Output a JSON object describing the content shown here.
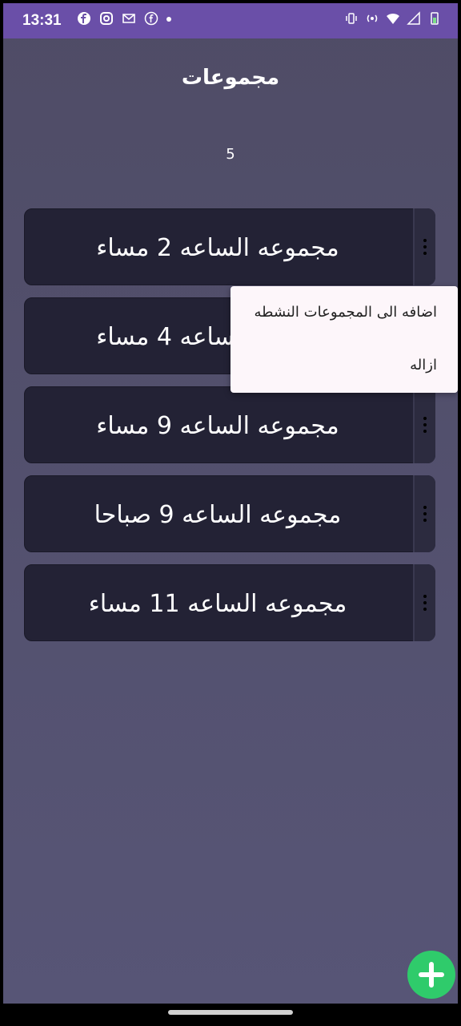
{
  "status_bar": {
    "time": "13:31",
    "left_icons": [
      "facebook-icon",
      "instagram-icon",
      "gmail-icon",
      "facebook-icon"
    ],
    "right_icons": [
      "vibrate-icon",
      "hotspot-icon",
      "wifi-icon",
      "signal-icon",
      "battery-icon"
    ]
  },
  "header": {
    "title": "مجموعات",
    "count": "5"
  },
  "groups": [
    {
      "label": "مجموعه الساعه 2 مساء"
    },
    {
      "label": "مجموعه الساعه 4 مساء"
    },
    {
      "label": "مجموعه الساعه 9 مساء"
    },
    {
      "label": "مجموعه الساعه 9 صباحا"
    },
    {
      "label": "مجموعه الساعه 11 مساء"
    }
  ],
  "popup_menu": {
    "items": [
      {
        "label": "اضافه الى المجموعات النشطه"
      },
      {
        "label": "ازاله"
      }
    ]
  },
  "fab": {
    "icon": "plus-icon"
  },
  "colors": {
    "status_bar": "#6a4fa8",
    "background": "#524f6e",
    "card": "#232235",
    "fab": "#2fcb6b"
  }
}
